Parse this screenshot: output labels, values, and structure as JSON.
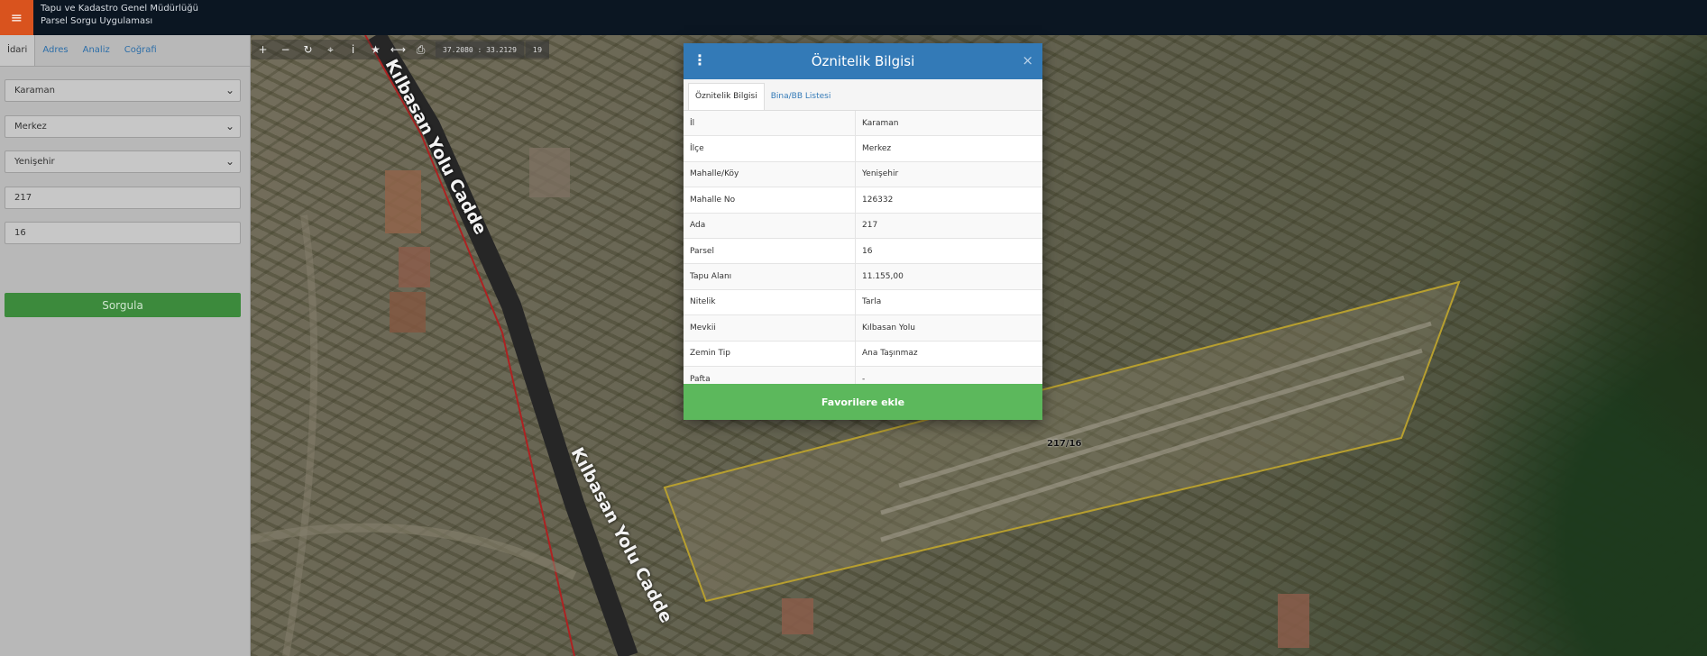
{
  "header": {
    "menu_icon": "hamburger-icon",
    "title_line1": "Tapu ve Kadastro Genel Müdürlüğü",
    "title_line2": "Parsel Sorgu Uygulaması"
  },
  "sidebar": {
    "tabs": [
      {
        "label": "İdari",
        "active": true
      },
      {
        "label": "Adres",
        "active": false
      },
      {
        "label": "Analiz",
        "active": false
      },
      {
        "label": "Coğrafi",
        "active": false
      }
    ],
    "fields": {
      "il": "Karaman",
      "ilce": "Merkez",
      "mahalle": "Yenişehir",
      "ada": "217",
      "parsel": "16"
    },
    "submit_label": "Sorgula"
  },
  "map": {
    "toolbar_icons": [
      "zoom-in-icon",
      "zoom-out-icon",
      "refresh-icon",
      "locate-icon",
      "info-icon",
      "star-icon",
      "measure-icon",
      "print-icon"
    ],
    "coordinates": "37.2080 : 33.2129",
    "zoom": "19",
    "road_label_1": "Kılbasan Yolu Cadde",
    "road_label_2": "Kılbasan Yolu Cadde",
    "parcel_label": "217/16"
  },
  "modal": {
    "title": "Öznitelik Bilgisi",
    "tabs": [
      {
        "label": "Öznitelik Bilgisi",
        "active": true
      },
      {
        "label": "Bina/BB Listesi",
        "active": false
      }
    ],
    "rows": [
      {
        "key": "İl",
        "value": "Karaman"
      },
      {
        "key": "İlçe",
        "value": "Merkez"
      },
      {
        "key": "Mahalle/Köy",
        "value": "Yenişehir"
      },
      {
        "key": "Mahalle No",
        "value": "126332"
      },
      {
        "key": "Ada",
        "value": "217"
      },
      {
        "key": "Parsel",
        "value": "16"
      },
      {
        "key": "Tapu Alanı",
        "value": "11.155,00"
      },
      {
        "key": "Nitelik",
        "value": "Tarla"
      },
      {
        "key": "Mevkii",
        "value": "Kılbasan Yolu"
      },
      {
        "key": "Zemin Tip",
        "value": "Ana Taşınmaz"
      },
      {
        "key": "Pafta",
        "value": "-"
      }
    ],
    "favorite_label": "Favorilere ekle"
  }
}
